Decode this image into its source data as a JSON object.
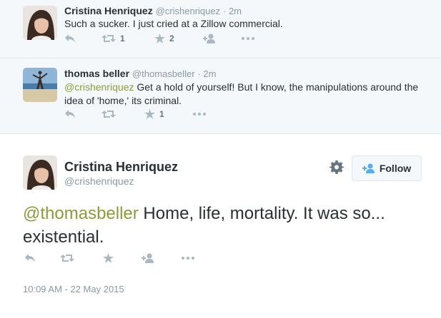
{
  "reply1": {
    "name": "Cristina Henriquez",
    "handle": "@crishenriquez",
    "time": "· 2m",
    "text": "Such a sucker. I just cried at a Zillow commercial.",
    "retweets": "1",
    "favorites": "2"
  },
  "reply2": {
    "name": "thomas beller",
    "handle": "@thomasbeller",
    "time": "· 2m",
    "mention": "@crishenriquez",
    "text": " Get a hold of yourself! But I know, the manipulations around the idea of 'home,' its criminal.",
    "favorites": "1"
  },
  "main": {
    "name": "Cristina Henriquez",
    "handle": "@crishenriquez",
    "follow_label": "Follow",
    "mention": "@thomasbeller",
    "text": " Home, life, mortality. It was so... existential.",
    "timestamp": "10:09 AM - 22 May 2015"
  },
  "colors": {
    "mention": "#8d9b3a",
    "follow_icon": "#55acee",
    "action_icon": "#aab8c2"
  },
  "icons": [
    "reply-icon",
    "retweet-icon",
    "favorite-icon",
    "follow-icon",
    "more-icon",
    "gear-icon"
  ]
}
